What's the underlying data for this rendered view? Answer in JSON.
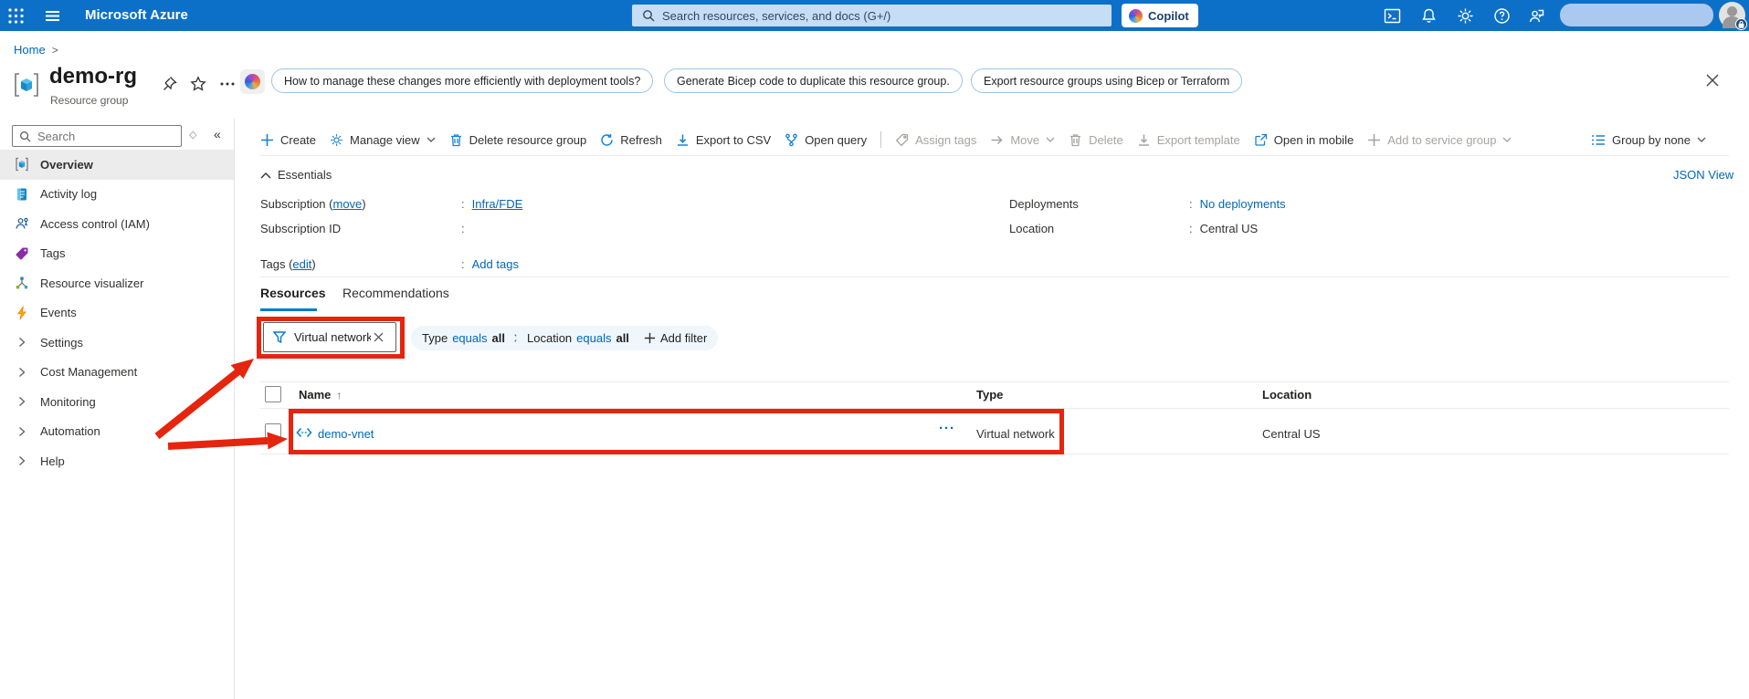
{
  "topbar": {
    "brand": "Microsoft Azure",
    "search_placeholder": "Search resources, services, and docs (G+/)",
    "copilot_label": "Copilot"
  },
  "breadcrumb": {
    "home": "Home",
    "separator": ">"
  },
  "header": {
    "title": "demo-rg",
    "subtitle": "Resource group",
    "suggestions": [
      "How to manage these changes more efficiently with deployment tools?",
      "Generate Bicep code to duplicate this resource group.",
      "Export resource groups using Bicep or Terraform"
    ]
  },
  "command_bar": {
    "items": [
      {
        "label": "Create",
        "icon": "plus-icon",
        "disabled": false
      },
      {
        "label": "Manage view",
        "icon": "gear-icon",
        "disabled": false
      },
      {
        "label": "Delete resource group",
        "icon": "trash-icon",
        "disabled": false
      },
      {
        "label": "Refresh",
        "icon": "refresh-icon",
        "disabled": false
      },
      {
        "label": "Export to CSV",
        "icon": "download-icon",
        "disabled": false
      },
      {
        "label": "Open query",
        "icon": "branch-icon",
        "disabled": false
      },
      {
        "label": "Assign tags",
        "icon": "tag-icon",
        "disabled": true
      },
      {
        "label": "Move",
        "icon": "arrow-right-icon",
        "disabled": true
      },
      {
        "label": "Delete",
        "icon": "trash-icon",
        "disabled": true
      },
      {
        "label": "Export template",
        "icon": "download-icon",
        "disabled": true
      },
      {
        "label": "Open in mobile",
        "icon": "share-icon",
        "disabled": false
      },
      {
        "label": "Add to service group",
        "icon": "plus-icon",
        "disabled": true
      }
    ],
    "group_by": "Group by none"
  },
  "essentials": {
    "title": "Essentials",
    "json_view": "JSON View",
    "colon": ":",
    "left": [
      {
        "label_pre": "Subscription (",
        "action": "move",
        "label_post": ")",
        "value": "Infra/FDE"
      },
      {
        "label_pre": "Subscription ID",
        "action": "",
        "label_post": "",
        "value": ""
      },
      {
        "label_pre": "Tags (",
        "action": "edit",
        "label_post": ")",
        "value": "Add tags"
      }
    ],
    "right": [
      {
        "label": "Deployments",
        "value": "No deployments"
      },
      {
        "label": "Location",
        "value": "Central US"
      }
    ]
  },
  "tabs": [
    {
      "label": "Resources"
    },
    {
      "label": "Recommendations"
    }
  ],
  "filters": {
    "search_value": "Virtual network",
    "pills": [
      {
        "field": "Type",
        "op": "equals",
        "value": "all"
      },
      {
        "field": "Location",
        "op": "equals",
        "value": "all"
      }
    ],
    "add_filter": "Add filter"
  },
  "table": {
    "columns": [
      "Name",
      "Type",
      "Location"
    ],
    "sort_indicator": "↑",
    "rows": [
      {
        "name": "demo-vnet",
        "type": "Virtual network",
        "location": "Central US",
        "menu": "···"
      }
    ]
  },
  "sidebar": {
    "search_placeholder": "Search",
    "shortcut_glyph": "◇",
    "collapse_glyph": "«",
    "items": [
      {
        "label": "Overview"
      },
      {
        "label": "Activity log"
      },
      {
        "label": "Access control (IAM)"
      },
      {
        "label": "Tags"
      },
      {
        "label": "Resource visualizer"
      },
      {
        "label": "Events"
      },
      {
        "label": "Settings"
      },
      {
        "label": "Cost Management"
      },
      {
        "label": "Monitoring"
      },
      {
        "label": "Automation"
      },
      {
        "label": "Help"
      }
    ]
  },
  "colors": {
    "topbar_blue": "#0d70c8",
    "accent_blue": "#0078d4",
    "link_blue": "#0067b8",
    "annotation_red": "#e5250e"
  }
}
